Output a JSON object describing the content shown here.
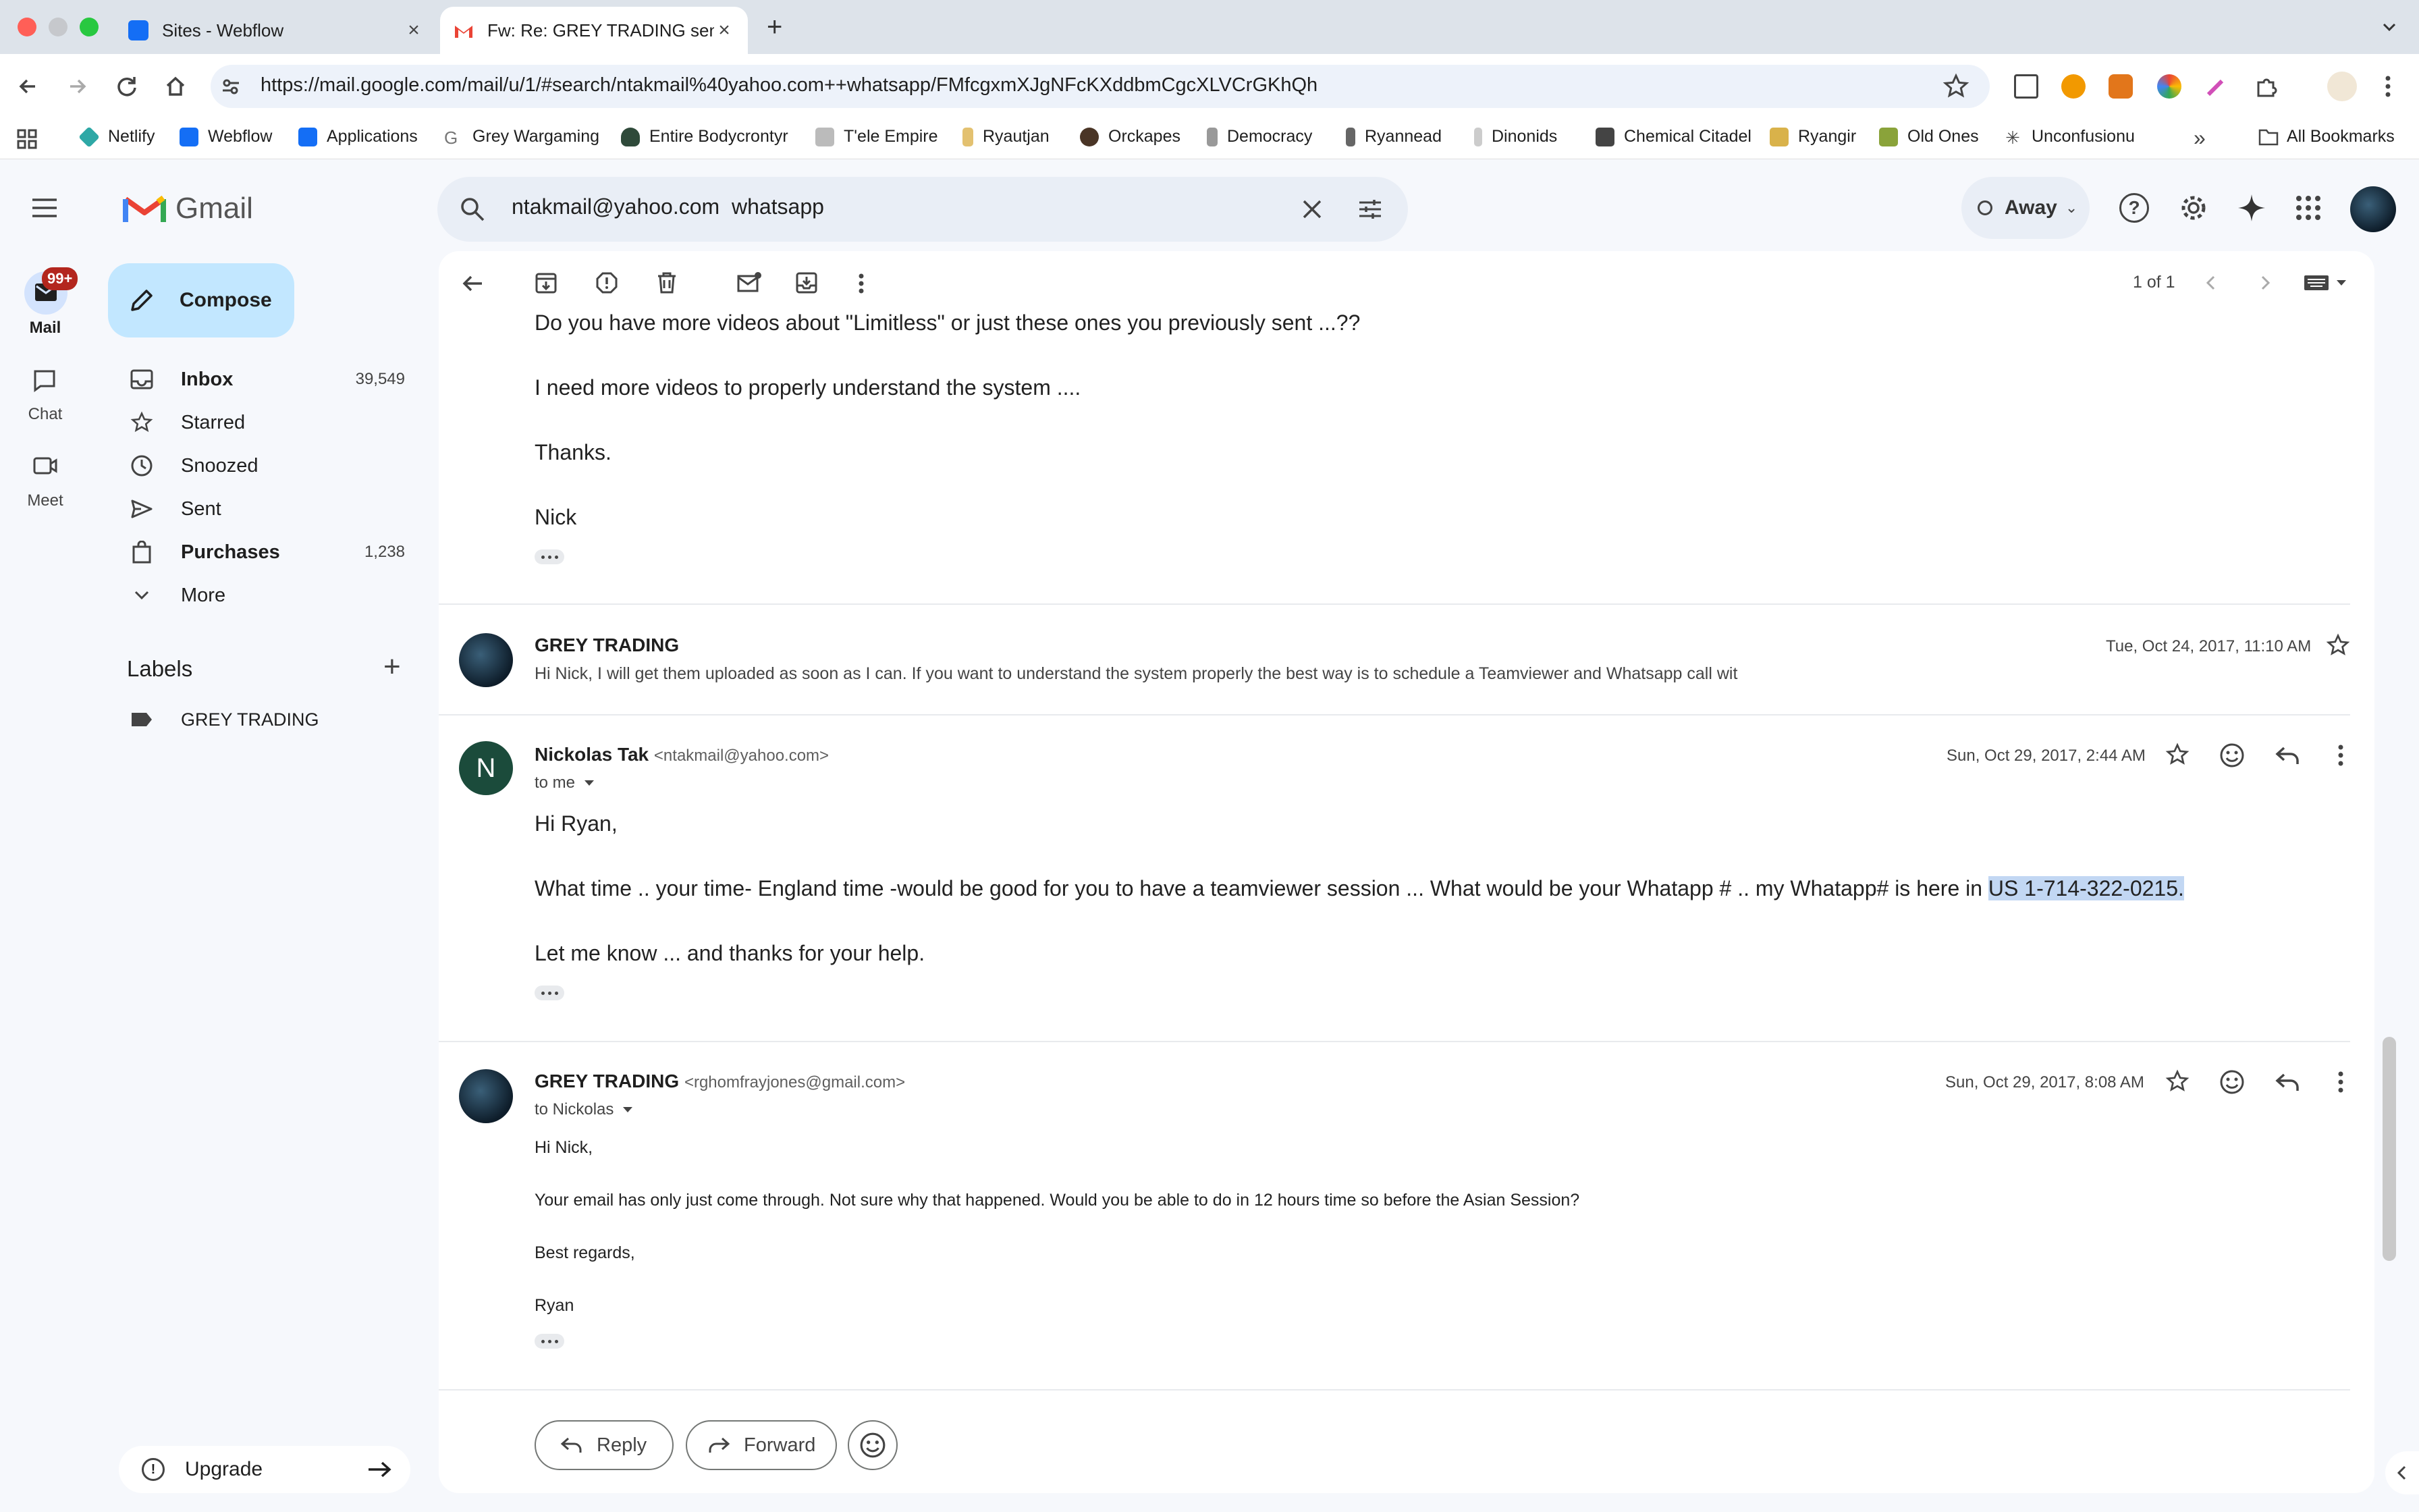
{
  "browser": {
    "tabs": [
      {
        "title": "Sites - Webflow",
        "active": false
      },
      {
        "title": "Fw: Re: GREY TRADING sent",
        "active": true
      }
    ],
    "url": "https://mail.google.com/mail/u/1/#search/ntakmail%40yahoo.com++whatsapp/FMfcgxmXJgNFcKXddbmCgcXLVCrGKhQh",
    "bookmarks": [
      "Netlify",
      "Webflow",
      "Applications",
      "Grey Wargaming",
      "Entire Bodycrontyr",
      "T'ele Empire",
      "Ryautjan",
      "Orckapes",
      "Democracy",
      "Ryannead",
      "Dinonids",
      "Chemical Citadel",
      "Ryangir",
      "Old Ones",
      "Unconfusionu"
    ],
    "all_bookmarks": "All Bookmarks"
  },
  "gmail": {
    "logo": "Gmail",
    "rail": {
      "mail": "Mail",
      "mail_badge": "99+",
      "chat": "Chat",
      "meet": "Meet"
    },
    "compose": "Compose",
    "nav": [
      {
        "label": "Inbox",
        "count": "39,549",
        "bold": true
      },
      {
        "label": "Starred",
        "count": ""
      },
      {
        "label": "Snoozed",
        "count": ""
      },
      {
        "label": "Sent",
        "count": ""
      },
      {
        "label": "Purchases",
        "count": "1,238",
        "bold": true
      },
      {
        "label": "More",
        "count": ""
      }
    ],
    "labels_heading": "Labels",
    "labels": [
      "GREY TRADING"
    ],
    "upgrade": "Upgrade",
    "search_query": "ntakmail@yahoo.com  whatsapp",
    "status": "Away",
    "pager": "1 of 1"
  },
  "thread": {
    "msg0": {
      "lines": [
        "Do you have more videos about \"Limitless\" or just these ones you previously sent ...??",
        "I need more videos to properly understand the system ....",
        "Thanks.",
        "Nick"
      ]
    },
    "msg1": {
      "sender": "GREY TRADING",
      "date": "Tue, Oct 24, 2017, 11:10 AM",
      "snippet": "Hi Nick, I will get them uploaded as soon as I can. If you want to understand the system properly the best way is to schedule a Teamviewer and Whatsapp call wit"
    },
    "msg2": {
      "sender": "Nickolas Tak",
      "email": "<ntakmail@yahoo.com>",
      "avatar_letter": "N",
      "to": "to me",
      "date": "Sun, Oct 29, 2017, 2:44 AM",
      "greeting": "Hi Ryan,",
      "line1": "What time .. your time- England time -would be good for you to have a teamviewer session ... What would be your Whatapp # .. my Whatapp# is here in ",
      "line1_highlight": "US 1-714-322-0215.",
      "line2": "Let me know ... and thanks for your help."
    },
    "msg3": {
      "sender": "GREY TRADING",
      "email": "<rghomfrayjones@gmail.com>",
      "to": "to Nickolas",
      "date": "Sun, Oct 29, 2017, 8:08 AM",
      "lines": [
        "Hi Nick,",
        "Your email has only just come through. Not sure why that happened. Would you be able to do in 12 hours time so before the Asian Session?",
        "Best regards,",
        "Ryan"
      ]
    },
    "actions": {
      "reply": "Reply",
      "forward": "Forward"
    }
  }
}
